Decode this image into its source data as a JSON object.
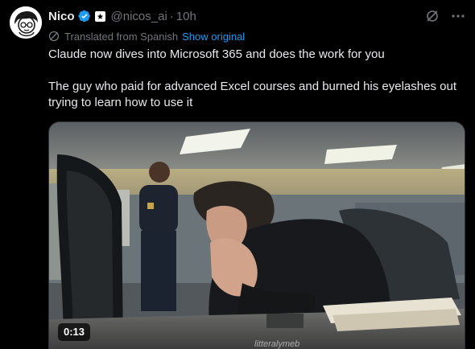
{
  "post": {
    "author_name": "Nico",
    "handle": "@nicos_ai",
    "separator": "·",
    "time": "10h",
    "translation_note": "Translated from Spanish",
    "show_original": "Show original",
    "text_line1": "Claude now dives into Microsoft 365 and does the work for you",
    "text_line2": "The guy who paid for advanced Excel courses and burned his eyelashes out trying to learn how to use it"
  },
  "media": {
    "duration": "0:13",
    "watermark": "litteralymeb"
  },
  "icons": {
    "verified": "verified-badge-icon",
    "affiliate": "affiliate-badge-icon",
    "grok": "grok-icon",
    "more": "more-icon",
    "translate": "translate-icon"
  },
  "colors": {
    "background": "#000000",
    "text": "#e7e9ea",
    "muted": "#71767b",
    "link": "#1d9bf0",
    "verified": "#1d9bf0"
  }
}
